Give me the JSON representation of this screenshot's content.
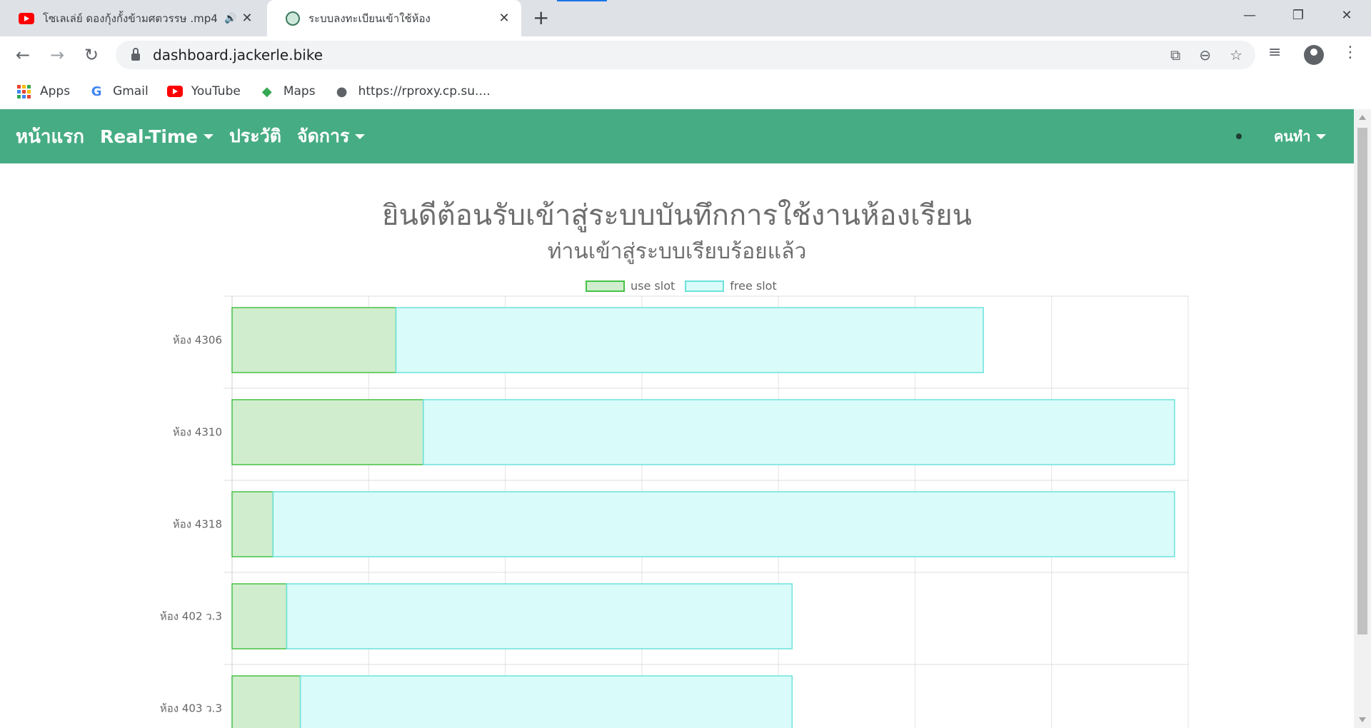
{
  "browser": {
    "tabs": [
      {
        "title": "โซเลเล่ย์ ดองกุ้งกั้งข้ามศตวรรษ .mp4",
        "icon": "youtube-icon",
        "audio": true
      },
      {
        "title": "ระบบลงทะเบียนเข้าใช้ห้อง",
        "icon": "site-icon",
        "audio": false
      }
    ],
    "url": "dashboard.jackerle.bike",
    "bookmarks": [
      {
        "label": "Apps",
        "icon": "apps-grid-icon"
      },
      {
        "label": "Gmail",
        "icon": "google-icon"
      },
      {
        "label": "YouTube",
        "icon": "youtube-icon"
      },
      {
        "label": "Maps",
        "icon": "maps-icon"
      },
      {
        "label": "https://rproxy.cp.su....",
        "icon": "globe-icon"
      }
    ]
  },
  "navbar": {
    "brand": "หน้าแรก",
    "items": [
      {
        "label": "Real-Time",
        "dropdown": true
      },
      {
        "label": "ประวัติ",
        "dropdown": false
      },
      {
        "label": "จัดการ",
        "dropdown": true
      }
    ],
    "user": "คนทำ",
    "bg_color": "#46ac84"
  },
  "headline": {
    "title": "ยินดีต้อนรับเข้าสู่ระบบบันทึกการใช้งานห้องเรียน",
    "subtitle": "ท่านเข้าสู่ระบบเรียบร้อยแล้ว"
  },
  "chart_data": {
    "type": "bar",
    "orientation": "horizontal",
    "stacked": true,
    "categories": [
      "ห้อง 4306",
      "ห้อง 4310",
      "ห้อง 4318",
      "ห้อง 402 ว.3",
      "ห้อง 403 ว.3"
    ],
    "series": [
      {
        "name": "use slot",
        "values": [
          12,
          14,
          3,
          4,
          5
        ],
        "fill": "#d0eecd",
        "stroke": "#45c247"
      },
      {
        "name": "free slot",
        "values": [
          43,
          55,
          66,
          37,
          36
        ],
        "fill": "#d9fbf9",
        "stroke": "#6ce2dc"
      }
    ],
    "xlim": [
      0,
      70
    ],
    "legend": "top",
    "grid": true
  }
}
